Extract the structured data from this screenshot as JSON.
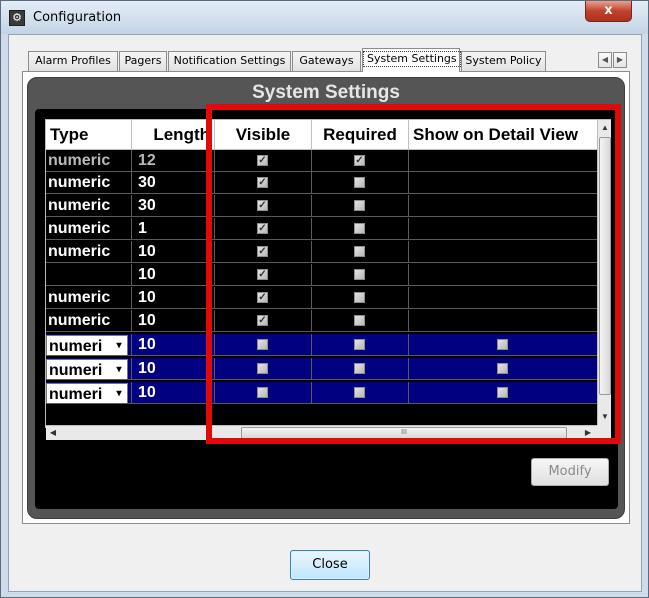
{
  "window": {
    "title": "Configuration",
    "close_glyph": "x"
  },
  "tabs": [
    {
      "label": "Alarm Profiles"
    },
    {
      "label": "Pagers"
    },
    {
      "label": "Notification Settings"
    },
    {
      "label": "Gateways"
    },
    {
      "label": "System Settings",
      "active": true
    },
    {
      "label": "System Policy"
    }
  ],
  "panel": {
    "title": "System Settings"
  },
  "grid": {
    "columns": [
      "Type",
      "Length",
      "Visible",
      "Required",
      "Show on Detail View"
    ],
    "rows": [
      {
        "type": "numeric",
        "length": "12",
        "visible": true,
        "required": true,
        "detail": null,
        "style": "disabled"
      },
      {
        "type": "numeric",
        "length": "30",
        "visible": true,
        "required": false,
        "detail": null,
        "style": "normal"
      },
      {
        "type": "numeric",
        "length": "30",
        "visible": true,
        "required": false,
        "detail": null,
        "style": "normal"
      },
      {
        "type": "numeric",
        "length": "1",
        "visible": true,
        "required": false,
        "detail": null,
        "style": "normal"
      },
      {
        "type": "numeric",
        "length": "10",
        "visible": true,
        "required": false,
        "detail": null,
        "style": "normal"
      },
      {
        "type": "",
        "length": "10",
        "visible": true,
        "required": false,
        "detail": null,
        "style": "normal"
      },
      {
        "type": "numeric",
        "length": "10",
        "visible": true,
        "required": false,
        "detail": null,
        "style": "normal"
      },
      {
        "type": "numeric",
        "length": "10",
        "visible": true,
        "required": false,
        "detail": null,
        "style": "normal"
      },
      {
        "type": "numeri",
        "length": "10",
        "visible": false,
        "required": false,
        "detail": false,
        "style": "selected"
      },
      {
        "type": "numeri",
        "length": "10",
        "visible": false,
        "required": false,
        "detail": false,
        "style": "selected"
      },
      {
        "type": "numeri",
        "length": "10",
        "visible": false,
        "required": false,
        "detail": false,
        "style": "selected"
      }
    ],
    "hscroll_grip": "III"
  },
  "buttons": {
    "modify": "Modify",
    "close": "Close"
  },
  "colors": {
    "highlight_border": "#e10a0a",
    "selected_row": "#000080",
    "panel_frame": "#555555"
  }
}
